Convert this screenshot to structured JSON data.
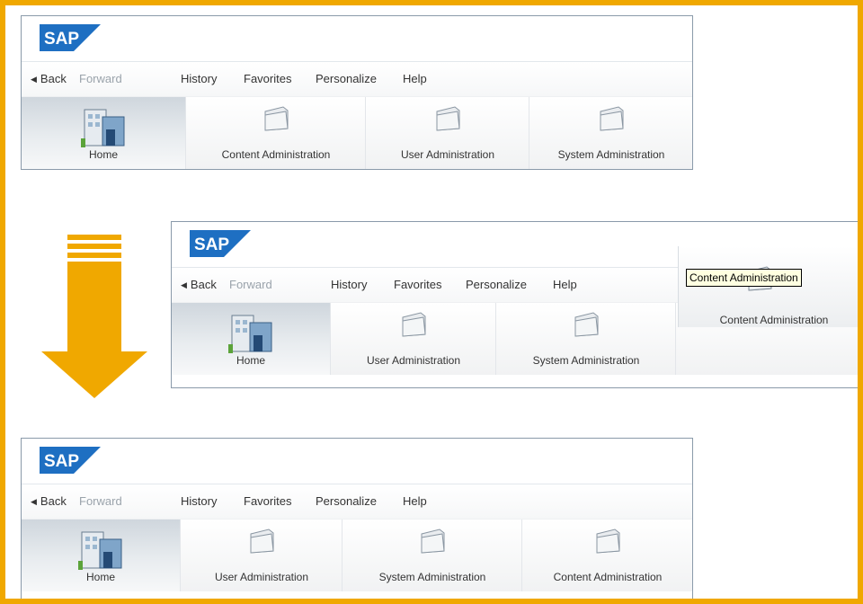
{
  "colors": {
    "frame_border": "#f0a800",
    "arrow": "#f0a800",
    "sap_blue": "#1e6fc2"
  },
  "portals": [
    {
      "logo_text": "SAP",
      "nav": {
        "back": "Back",
        "forward": "Forward",
        "history": "History",
        "favorites": "Favorites",
        "personalize": "Personalize",
        "help": "Help"
      },
      "tabs": [
        {
          "label": "Home",
          "icon": "building-icon"
        },
        {
          "label": "Content Administration",
          "icon": "folder-icon"
        },
        {
          "label": "User Administration",
          "icon": "folder-icon"
        },
        {
          "label": "System Administration",
          "icon": "folder-icon"
        }
      ]
    },
    {
      "logo_text": "SAP",
      "nav": {
        "back": "Back",
        "forward": "Forward",
        "history": "History",
        "favorites": "Favorites",
        "personalize": "Personalize",
        "help": "Help"
      },
      "tabs": [
        {
          "label": "Home",
          "icon": "building-icon"
        },
        {
          "label": "User Administration",
          "icon": "folder-icon"
        },
        {
          "label": "System Administration",
          "icon": "folder-icon"
        }
      ],
      "dragged_tab": {
        "label": "Content Administration",
        "tooltip": "Content Administration",
        "icon": "folder-icon"
      }
    },
    {
      "logo_text": "SAP",
      "nav": {
        "back": "Back",
        "forward": "Forward",
        "history": "History",
        "favorites": "Favorites",
        "personalize": "Personalize",
        "help": "Help"
      },
      "tabs": [
        {
          "label": "Home",
          "icon": "building-icon"
        },
        {
          "label": "User Administration",
          "icon": "folder-icon"
        },
        {
          "label": "System Administration",
          "icon": "folder-icon"
        },
        {
          "label": "Content Administration",
          "icon": "folder-icon"
        }
      ]
    }
  ]
}
